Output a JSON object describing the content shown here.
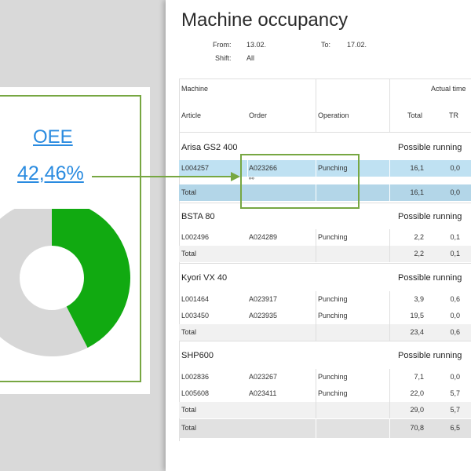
{
  "report": {
    "title": "Machine occupancy",
    "from_label": "From:",
    "from_value": "13.02.",
    "to_label": "To:",
    "to_value": "17.02.",
    "shift_label": "Shift:",
    "shift_value": "All"
  },
  "table_headers": {
    "machine": "Machine",
    "article": "Article",
    "order": "Order",
    "operation": "Operation",
    "actual_time": "Actual time",
    "total": "Total",
    "tr": "TR"
  },
  "groups": [
    {
      "name": "Arisa GS2 400",
      "sub": "Possible running",
      "rows": [
        {
          "article": "L004257",
          "order": "A023266",
          "operation": "Punching",
          "total": "16,1",
          "tr": "0,0"
        }
      ],
      "total_label": "Total",
      "total_total": "16,1",
      "total_tr": "0,0"
    },
    {
      "name": "BSTA 80",
      "sub": "Possible running",
      "rows": [
        {
          "article": "L002496",
          "order": "A024289",
          "operation": "Punching",
          "total": "2,2",
          "tr": "0,1"
        }
      ],
      "total_label": "Total",
      "total_total": "2,2",
      "total_tr": "0,1"
    },
    {
      "name": "Kyori VX 40",
      "sub": "Possible running",
      "rows": [
        {
          "article": "L001464",
          "order": "A023917",
          "operation": "Punching",
          "total": "3,9",
          "tr": "0,6"
        },
        {
          "article": "L003450",
          "order": "A023935",
          "operation": "Punching",
          "total": "19,5",
          "tr": "0,0"
        }
      ],
      "total_label": "Total",
      "total_total": "23,4",
      "total_tr": "0,6"
    },
    {
      "name": "SHP600",
      "sub": "Possible running",
      "rows": [
        {
          "article": "L002836",
          "order": "A023267",
          "operation": "Punching",
          "total": "7,1",
          "tr": "0,0"
        },
        {
          "article": "L005608",
          "order": "A023411",
          "operation": "Punching",
          "total": "22,0",
          "tr": "5,7"
        }
      ],
      "total_label": "Total",
      "total_total": "29,0",
      "total_tr": "5,7"
    }
  ],
  "grand_total": {
    "label": "Total",
    "total": "70,8",
    "tr": "6,5"
  },
  "oee": {
    "label": "OEE",
    "value_text": "42,46%",
    "fraction": 0.4246
  },
  "colors": {
    "accent_green": "#77a742",
    "donut_green": "#11aa11",
    "donut_grey": "#d7d7d7",
    "link_blue": "#2a8be0",
    "selected_row": "#bfe1f2"
  },
  "icons": {
    "order_link": "chain-link-icon"
  }
}
